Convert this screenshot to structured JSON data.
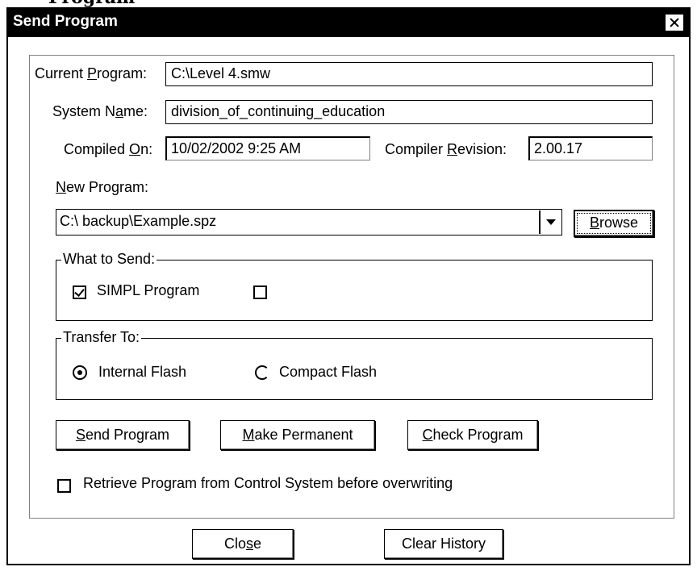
{
  "dialog": {
    "title": "Send Program"
  },
  "top_strip_text": "Program",
  "fields": {
    "current_program": {
      "label_pre": "Current ",
      "label_key": "P",
      "label_post": "rogram:",
      "value": "C:\\Level 4.smw"
    },
    "system_name": {
      "label_pre": "System N",
      "label_key": "a",
      "label_post": "me:",
      "value": "division_of_continuing_education"
    },
    "compiled_on": {
      "label_pre": "Compiled ",
      "label_key": "O",
      "label_post": "n:",
      "value": "10/02/2002 9:25 AM"
    },
    "compiler_revision": {
      "label_pre": "Compiler ",
      "label_key": "R",
      "label_post": "evision:",
      "value": "2.00.17"
    }
  },
  "new_program": {
    "label_key": "N",
    "label_post": "ew Program:",
    "value": "C:\\ backup\\Example.spz",
    "browse_key": "B",
    "browse_post": "rowse"
  },
  "what_to_send": {
    "legend": "What to Send:",
    "simpl_label": "SIMPL Program",
    "simpl_checked": true,
    "second_checked": false
  },
  "transfer_to": {
    "legend": "Transfer To:",
    "options": [
      "Internal Flash",
      "Compact Flash"
    ],
    "selected": "Internal Flash"
  },
  "actions": {
    "send_key": "S",
    "send_post": "end Program",
    "permanent_key": "M",
    "permanent_post": "ake Permanent",
    "check_key": "C",
    "check_post": "heck Program"
  },
  "retrieve": {
    "label": "Retrieve Program from Control System before overwriting",
    "checked": false
  },
  "footer": {
    "close_pre": "Clo",
    "close_key": "s",
    "close_post": "e",
    "clear_history": "Clear History"
  }
}
